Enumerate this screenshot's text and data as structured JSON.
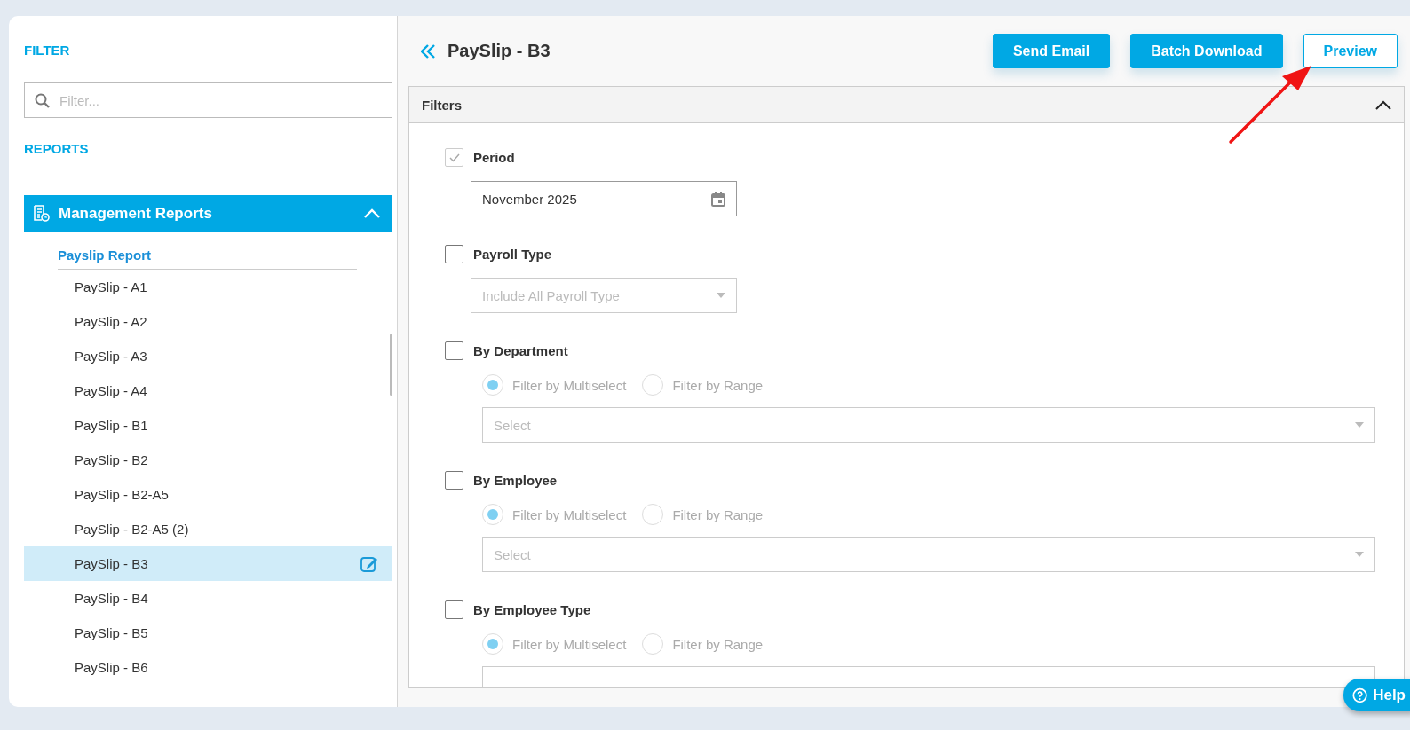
{
  "sidebar": {
    "filter_heading": "FILTER",
    "search": {
      "placeholder": "Filter..."
    },
    "reports_heading": "REPORTS",
    "group": {
      "title": "Management Reports",
      "expanded": true,
      "section": "Payslip Report",
      "items": [
        {
          "label": "PaySlip - A1",
          "selected": false
        },
        {
          "label": "PaySlip - A2",
          "selected": false
        },
        {
          "label": "PaySlip - A3",
          "selected": false
        },
        {
          "label": "PaySlip - A4",
          "selected": false
        },
        {
          "label": "PaySlip - B1",
          "selected": false
        },
        {
          "label": "PaySlip - B2",
          "selected": false
        },
        {
          "label": "PaySlip - B2-A5",
          "selected": false
        },
        {
          "label": "PaySlip - B2-A5 (2)",
          "selected": false
        },
        {
          "label": "PaySlip - B3",
          "selected": true
        },
        {
          "label": "PaySlip - B4",
          "selected": false
        },
        {
          "label": "PaySlip - B5",
          "selected": false
        },
        {
          "label": "PaySlip - B6",
          "selected": false
        }
      ]
    }
  },
  "main": {
    "title": "PaySlip - B3",
    "buttons": [
      {
        "label": "Send Email",
        "kind": "primary"
      },
      {
        "label": "Batch Download",
        "kind": "primary"
      },
      {
        "label": "Preview",
        "kind": "outline"
      }
    ],
    "filters": {
      "title": "Filters",
      "expanded": true,
      "groups": [
        {
          "kind": "date",
          "label": "Period",
          "checked": true,
          "disabled": true,
          "value": "November 2025"
        },
        {
          "kind": "dropdown",
          "label": "Payroll Type",
          "checked": false,
          "placeholder": "Include All Payroll Type"
        },
        {
          "kind": "multiselect",
          "label": "By Department",
          "checked": false,
          "options": [
            {
              "label": "Filter by Multiselect",
              "selected": true
            },
            {
              "label": "Filter by Range",
              "selected": false
            }
          ],
          "placeholder": "Select"
        },
        {
          "kind": "multiselect",
          "label": "By Employee",
          "checked": false,
          "options": [
            {
              "label": "Filter by Multiselect",
              "selected": true
            },
            {
              "label": "Filter by Range",
              "selected": false
            }
          ],
          "placeholder": "Select"
        },
        {
          "kind": "multiselect",
          "label": "By Employee Type",
          "checked": false,
          "options": [
            {
              "label": "Filter by Multiselect",
              "selected": true
            },
            {
              "label": "Filter by Range",
              "selected": false
            }
          ]
        }
      ]
    }
  },
  "help": {
    "label": "Help"
  }
}
